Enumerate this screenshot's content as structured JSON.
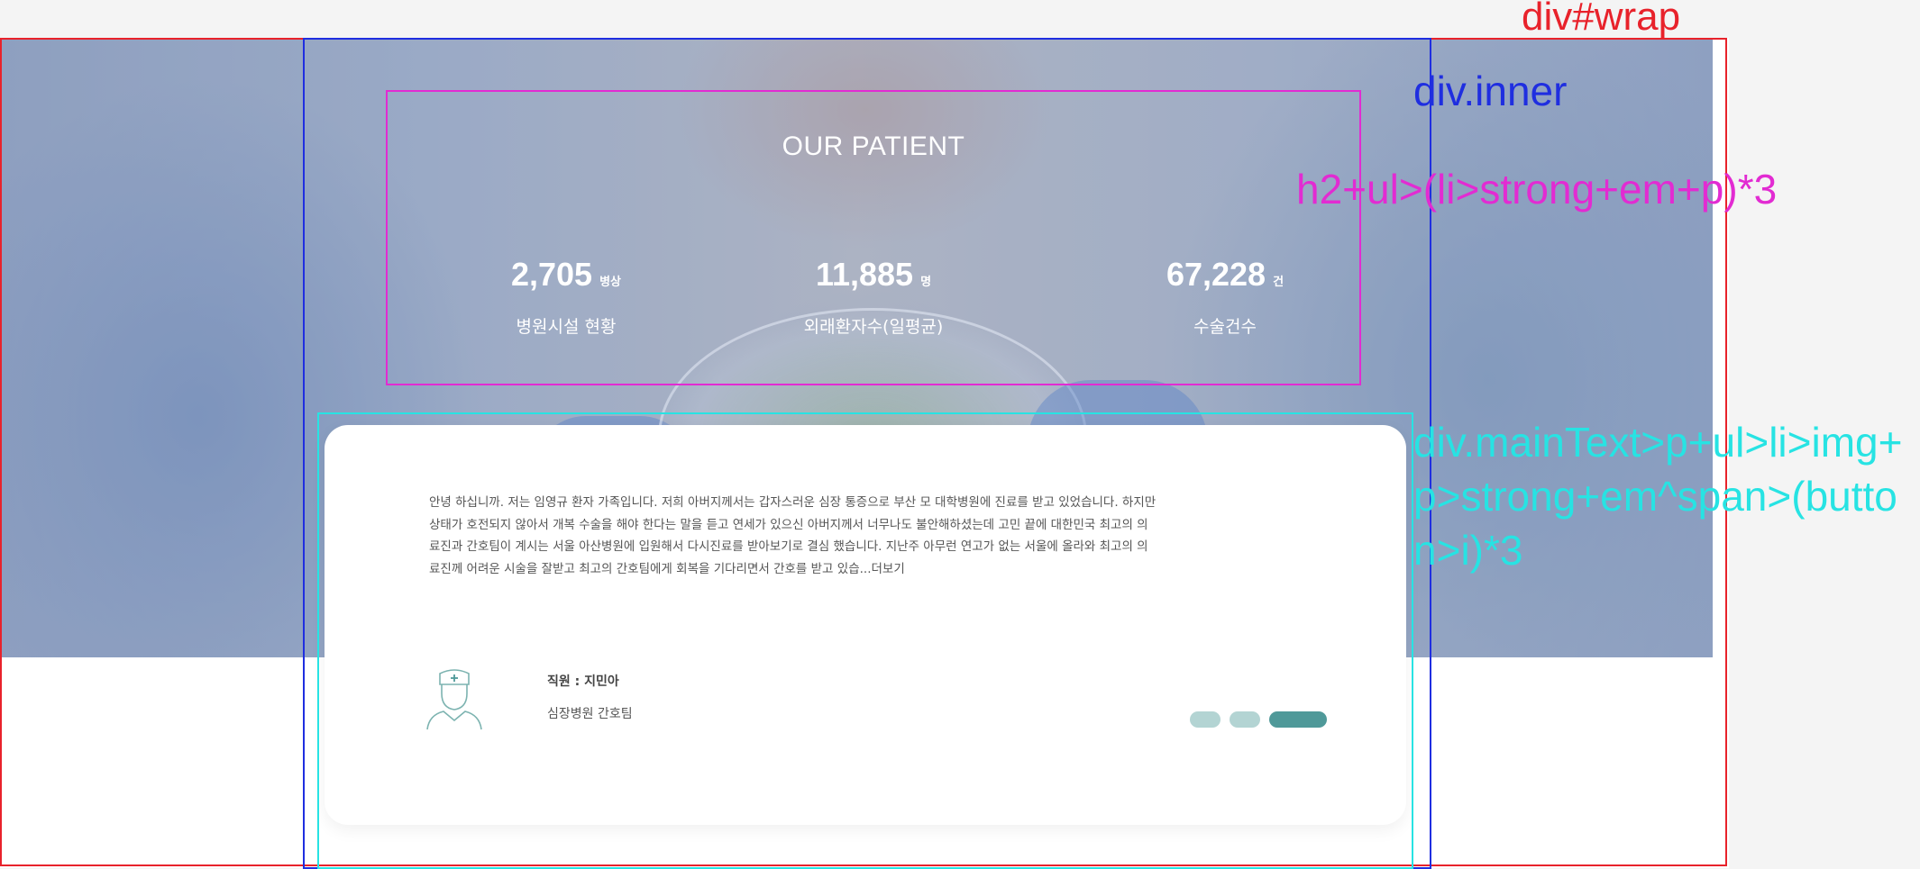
{
  "annotations": {
    "wrap": "div#wrap",
    "inner": "div.inner",
    "heading_list": "h2+ul>(li>strong+em+p)*3",
    "main_text": "div.mainText>p+ul>li>img+p>strong+em^span>(button>i)*3"
  },
  "patient": {
    "title": "OUR PATIENT",
    "stats": [
      {
        "value": "2,705",
        "unit": "병상",
        "label": "병원시설 현황"
      },
      {
        "value": "11,885",
        "unit": "명",
        "label": "외래환자수(일평균)"
      },
      {
        "value": "67,228",
        "unit": "건",
        "label": "수술건수"
      }
    ]
  },
  "main_text": {
    "paragraph": "안녕 하십니까. 저는 임영규 환자 가족입니다. 저희 아버지께서는 갑자스러운 심장 통증으로 부산 모 대학병원에 진료를 받고 있었습니다. 하지만 상태가 호전되지 않아서 개복 수술을 해야 한다는 말을 듣고 연세가 있으신 아버지께서 너무나도 불안해하셨는데 고민 끝에 대한민국 최고의 의료진과 간호팀이 계시는 서울 아산병원에 입원해서 다시진료를 받아보기로 결심 했습니다. 지난주 아무런 연고가 없는 서울에 올라와 최고의 의료진께 어려운 시술을 잘받고 최고의 간호팀에게 회복을 기다리면서 간호를 받고 있습...더보기",
    "author_name": "직원 : 지민아",
    "author_team": "심장병원 간호팀",
    "author_icon": "nurse-icon",
    "pager_colors": [
      "#b3d4d3",
      "#b3d4d3",
      "#4f9999"
    ]
  }
}
